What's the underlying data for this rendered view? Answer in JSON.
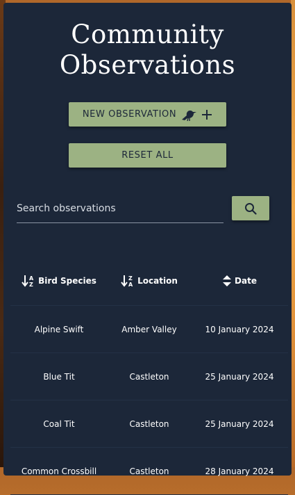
{
  "page": {
    "title": "Community Observations"
  },
  "actions": {
    "new_observation_label": "NEW OBSERVATION",
    "reset_all_label": "RESET ALL"
  },
  "search": {
    "placeholder": "Search observations",
    "value": ""
  },
  "table": {
    "columns": [
      {
        "label": "Bird Species",
        "sort_icon": "sort-alpha-down-icon"
      },
      {
        "label": "Location",
        "sort_icon": "sort-alpha-up-icon"
      },
      {
        "label": "Date",
        "sort_icon": "sort-both-icon"
      }
    ],
    "rows": [
      {
        "species": "Alpine Swift",
        "location": "Amber Valley",
        "date": "10 January 2024"
      },
      {
        "species": "Blue Tit",
        "location": "Castleton",
        "date": "25 January 2024"
      },
      {
        "species": "Coal Tit",
        "location": "Castleton",
        "date": "25 January 2024"
      },
      {
        "species": "Common Crossbill",
        "location": "Castleton",
        "date": "28 January 2024"
      }
    ]
  },
  "colors": {
    "panel": "#1c2739",
    "button": "#9cb283",
    "text": "#ffffff"
  }
}
